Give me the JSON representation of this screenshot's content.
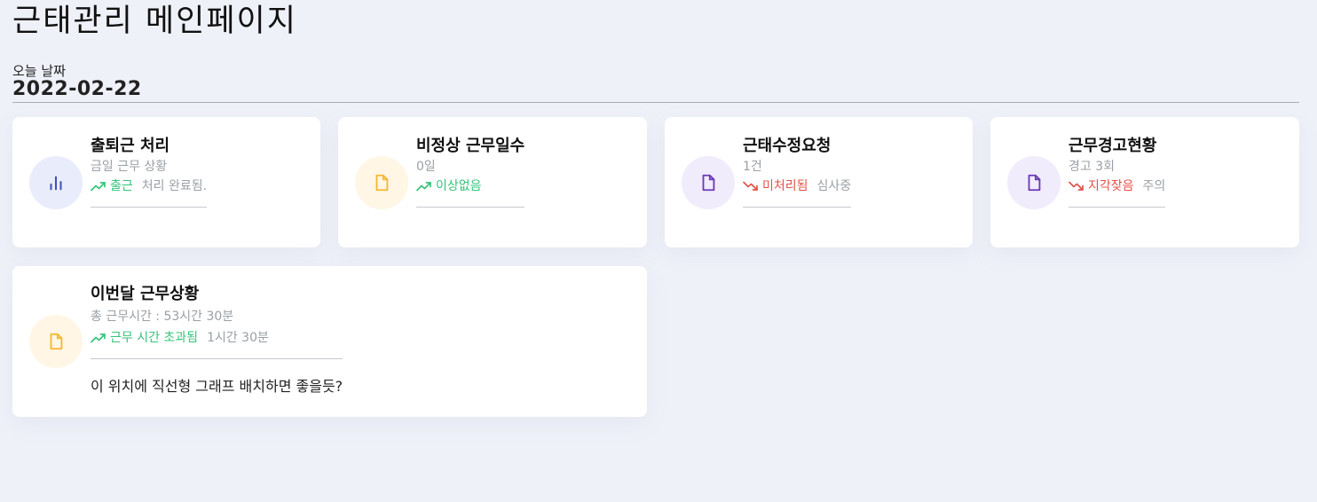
{
  "page": {
    "title": "근태관리 메인페이지",
    "date_label": "오늘 날짜",
    "date_value": "2022-02-22"
  },
  "cards": [
    {
      "title": "출퇴근 처리",
      "sub": "금일 근무 상황",
      "trend": "up",
      "trend_text": "출근",
      "note": "처리 완료됨.",
      "icon": "bar-chart-icon",
      "icon_color": "#3f51b5",
      "icon_bg": "#e9ecfa"
    },
    {
      "title": "비정상 근무일수",
      "sub": "0일",
      "trend": "up",
      "trend_text": "이상없음",
      "note": "",
      "icon": "document-icon",
      "icon_color": "#f5b82e",
      "icon_bg": "#fff6e6"
    },
    {
      "title": "근태수정요청",
      "sub": "1건",
      "trend": "down",
      "trend_text": "미처리됨",
      "note": "심사중",
      "icon": "document-icon",
      "icon_color": "#6a3ab8",
      "icon_bg": "#f1ecfc"
    },
    {
      "title": "근무경고현황",
      "sub": "경고 3회",
      "trend": "down",
      "trend_text": "지각잦음",
      "note": "주의",
      "icon": "document-icon",
      "icon_color": "#6a3ab8",
      "icon_bg": "#f1ecfc"
    }
  ],
  "monthly": {
    "title": "이번달 근무상황",
    "sub": "총 근무시간 : 53시간 30분",
    "trend": "up",
    "trend_text": "근무 시간 초과됨",
    "note": "1시간 30분",
    "desc": "이 위치에 직선형 그래프 배치하면 좋을듯?",
    "icon": "document-icon",
    "icon_color": "#f5b82e",
    "icon_bg": "#fff6e6"
  },
  "colors": {
    "up": "#35c47a",
    "down": "#e0534a",
    "muted": "#9aa0a6",
    "background": "#eff1f9"
  }
}
